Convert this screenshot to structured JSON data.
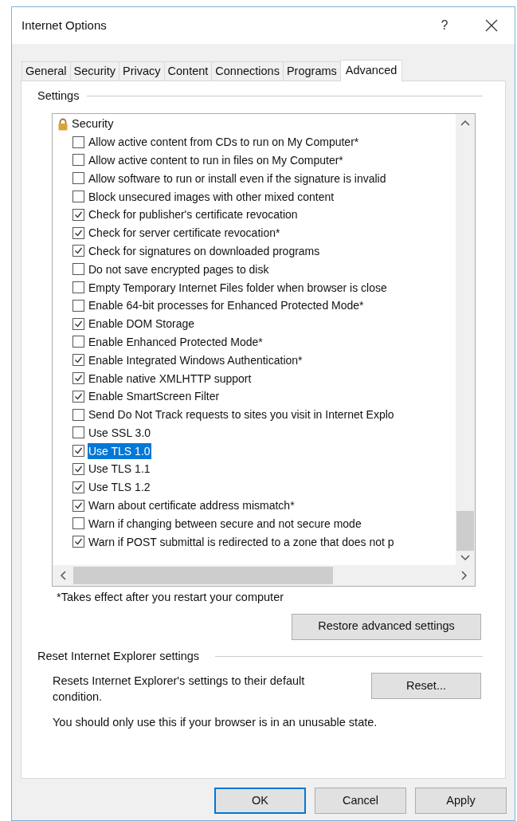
{
  "window": {
    "title": "Internet Options",
    "help": "?"
  },
  "tabs": [
    {
      "label": "General",
      "selected": false
    },
    {
      "label": "Security",
      "selected": false
    },
    {
      "label": "Privacy",
      "selected": false
    },
    {
      "label": "Content",
      "selected": false
    },
    {
      "label": "Connections",
      "selected": false
    },
    {
      "label": "Programs",
      "selected": false
    },
    {
      "label": "Advanced",
      "selected": true
    }
  ],
  "settings": {
    "title": "Settings",
    "group": {
      "label": "Security",
      "items": [
        {
          "label": "Allow active content from CDs to run on My Computer*",
          "checked": false,
          "selected": false
        },
        {
          "label": "Allow active content to run in files on My Computer*",
          "checked": false,
          "selected": false
        },
        {
          "label": "Allow software to run or install even if the signature is invalid",
          "checked": false,
          "selected": false
        },
        {
          "label": "Block unsecured images with other mixed content",
          "checked": false,
          "selected": false
        },
        {
          "label": "Check for publisher's certificate revocation",
          "checked": true,
          "selected": false
        },
        {
          "label": "Check for server certificate revocation*",
          "checked": true,
          "selected": false
        },
        {
          "label": "Check for signatures on downloaded programs",
          "checked": true,
          "selected": false
        },
        {
          "label": "Do not save encrypted pages to disk",
          "checked": false,
          "selected": false
        },
        {
          "label": "Empty Temporary Internet Files folder when browser is close",
          "checked": false,
          "selected": false
        },
        {
          "label": "Enable 64-bit processes for Enhanced Protected Mode*",
          "checked": false,
          "selected": false
        },
        {
          "label": "Enable DOM Storage",
          "checked": true,
          "selected": false
        },
        {
          "label": "Enable Enhanced Protected Mode*",
          "checked": false,
          "selected": false
        },
        {
          "label": "Enable Integrated Windows Authentication*",
          "checked": true,
          "selected": false
        },
        {
          "label": "Enable native XMLHTTP support",
          "checked": true,
          "selected": false
        },
        {
          "label": "Enable SmartScreen Filter",
          "checked": true,
          "selected": false
        },
        {
          "label": "Send Do Not Track requests to sites you visit in Internet Explo",
          "checked": false,
          "selected": false
        },
        {
          "label": "Use SSL 3.0",
          "checked": false,
          "selected": false
        },
        {
          "label": "Use TLS 1.0",
          "checked": true,
          "selected": true
        },
        {
          "label": "Use TLS 1.1",
          "checked": true,
          "selected": false
        },
        {
          "label": "Use TLS 1.2",
          "checked": true,
          "selected": false
        },
        {
          "label": "Warn about certificate address mismatch*",
          "checked": true,
          "selected": false
        },
        {
          "label": "Warn if changing between secure and not secure mode",
          "checked": false,
          "selected": false
        },
        {
          "label": "Warn if POST submittal is redirected to a zone that does not p",
          "checked": true,
          "selected": false
        }
      ]
    },
    "note": "*Takes effect after you restart your computer",
    "restore_button": "Restore advanced settings"
  },
  "reset": {
    "title": "Reset Internet Explorer settings",
    "description": "Resets Internet Explorer's settings to their default condition.",
    "button": "Reset...",
    "warning": "You should only use this if your browser is in an unusable state."
  },
  "buttons": [
    {
      "label": "OK",
      "default": true
    },
    {
      "label": "Cancel",
      "default": false
    },
    {
      "label": "Apply",
      "default": false
    }
  ]
}
